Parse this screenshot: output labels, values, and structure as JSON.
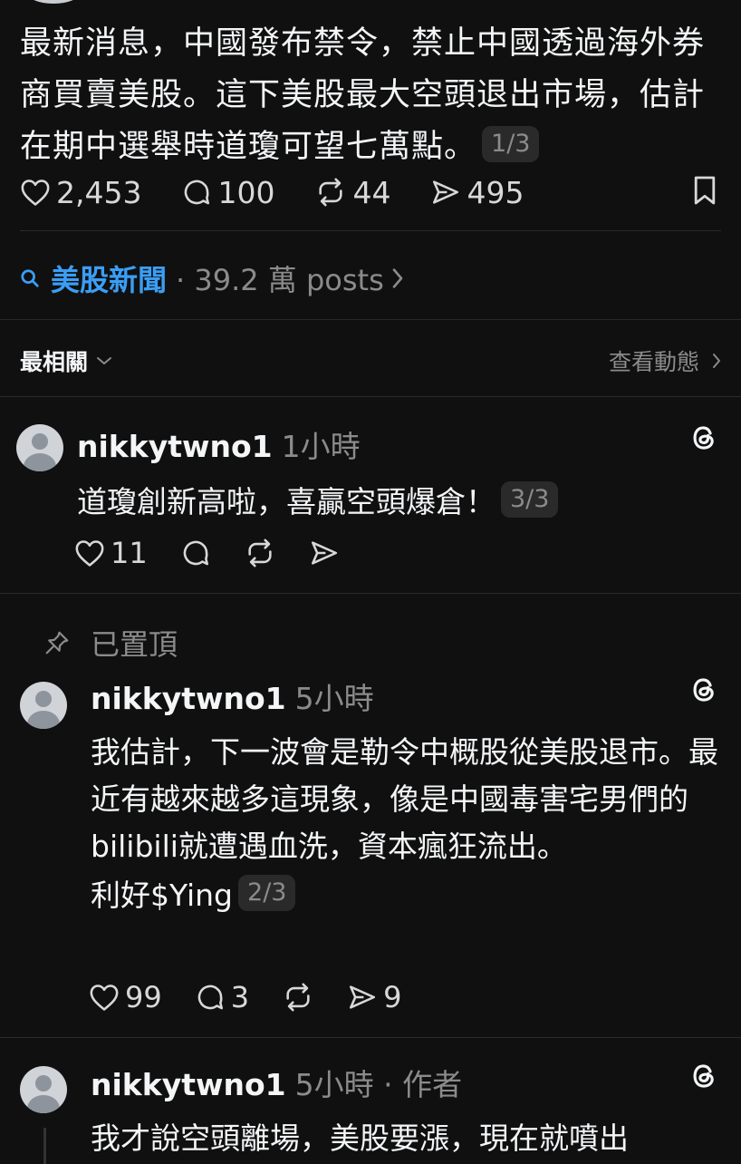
{
  "main_post": {
    "text": "最新消息，中國發布禁令，禁止中國透過海外券商買賣美股。這下美股最大空頭退出市場，估計在期中選舉時道瓊可望七萬點。",
    "page_indicator": "1/3",
    "likes": "2,453",
    "replies": "100",
    "reposts": "44",
    "shares": "495"
  },
  "tag": {
    "name": "美股新聞",
    "meta": "· 39.2 萬 posts"
  },
  "sort": {
    "label": "最相關",
    "view_activity": "查看動態"
  },
  "replies": [
    {
      "username": "nikkytwno1",
      "time": "1小時",
      "text": "道瓊創新高啦，喜贏空頭爆倉！",
      "page_indicator": "3/3",
      "likes": "11"
    },
    {
      "pinned_label": "已置頂",
      "username": "nikkytwno1",
      "time": "5小時",
      "text": "我估計，下一波會是勒令中概股從美股退市。最近有越來越多這現象，像是中國毒害宅男們的bilibili就遭遇血洗，資本瘋狂流出。",
      "text2": "利好$Ying",
      "page_indicator": "2/3",
      "likes": "99",
      "replies": "3",
      "shares": "9"
    },
    {
      "username": "nikkytwno1",
      "time": "5小時 · 作者",
      "text": "我才說空頭離場，美股要漲，現在就噴出"
    }
  ]
}
